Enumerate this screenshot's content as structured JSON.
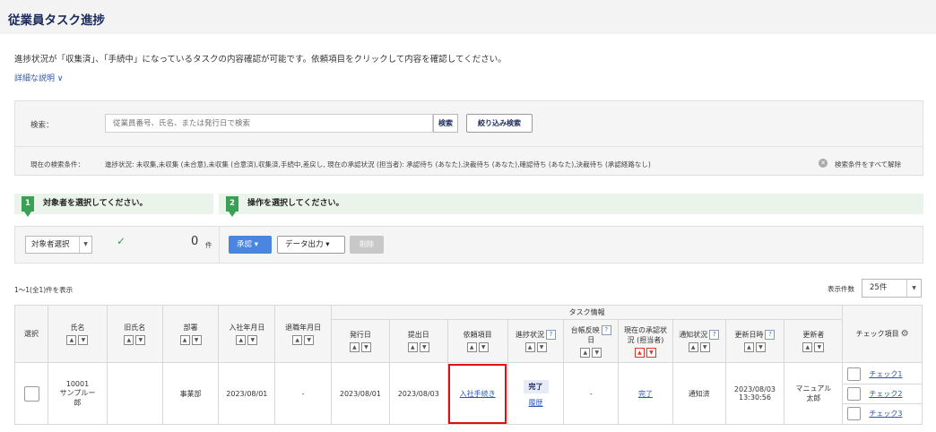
{
  "header": {
    "title": "従業員タスク進捗"
  },
  "intro": {
    "description": "進捗状況が「収集済」、「手続中」になっているタスクの内容確認が可能です。依頼項目をクリックして内容を確認してください。",
    "details_link": "詳細な説明 ∨"
  },
  "search": {
    "label": "検索：",
    "placeholder": "従業員番号、氏名、または発行日で検索",
    "search_button": "検索",
    "filter_button": "絞り込み検索",
    "conditions_label": "現在の検索条件：",
    "conditions_text": "進捗状況: 未収集,未収集 (未合意),未収集 (合意済),収集済,手続中,差戻し, 現在の承認状況 (担当者): 承認待ち (あなた),決裁待ち (あなた),確認待ち (あなた),決裁待ち (承認経路なし)",
    "clear_all": "検索条件をすべて解除"
  },
  "steps": [
    {
      "num": "1",
      "text": "対象者を選択してください。"
    },
    {
      "num": "2",
      "text": "操作を選択してください。"
    }
  ],
  "actions": {
    "select_target": "対象者選択",
    "selected_count": "0",
    "count_unit": "件",
    "approve": "承認 ▾",
    "export": "データ出力 ▾",
    "delete": "削除"
  },
  "list": {
    "range": "1～1(全1)件を表示",
    "per_page_label": "表示件数",
    "per_page": "25件"
  },
  "table": {
    "headers": {
      "select": "選択",
      "name": "氏名",
      "old_name": "旧氏名",
      "dept": "部署",
      "join_date": "入社年月日",
      "leave_date": "退職年月日",
      "task_info": "タスク情報",
      "issue_date": "発行日",
      "submit_date": "提出日",
      "request_item": "依頼項目",
      "progress": "進捗状況",
      "ledger_line1": "台帳反映",
      "ledger_line2": "日",
      "approval_line1": "現在の承認状",
      "approval_line2": "況 (担当者)",
      "notify": "通知状況",
      "updated_at": "更新日時",
      "updater": "更新者",
      "check_items": "チェック項目"
    },
    "rows": [
      {
        "emp_no": "10001",
        "name_line1": "サンプルー",
        "name_line2": "郎",
        "old_name": "",
        "dept": "事業部",
        "join_date": "2023/08/01",
        "leave_date": "-",
        "issue_date": "2023/08/01",
        "submit_date": "2023/08/03",
        "request_item": "入社手続き",
        "progress": "完了",
        "history": "履歴",
        "ledger": "-",
        "approval": "完了",
        "notify": "通知済",
        "updated_date": "2023/08/03",
        "updated_time": "13:30:56",
        "updater_line1": "マニュアル",
        "updater_line2": "太郎",
        "checks": [
          "チェック1",
          "チェック2",
          "チェック3"
        ]
      }
    ]
  }
}
